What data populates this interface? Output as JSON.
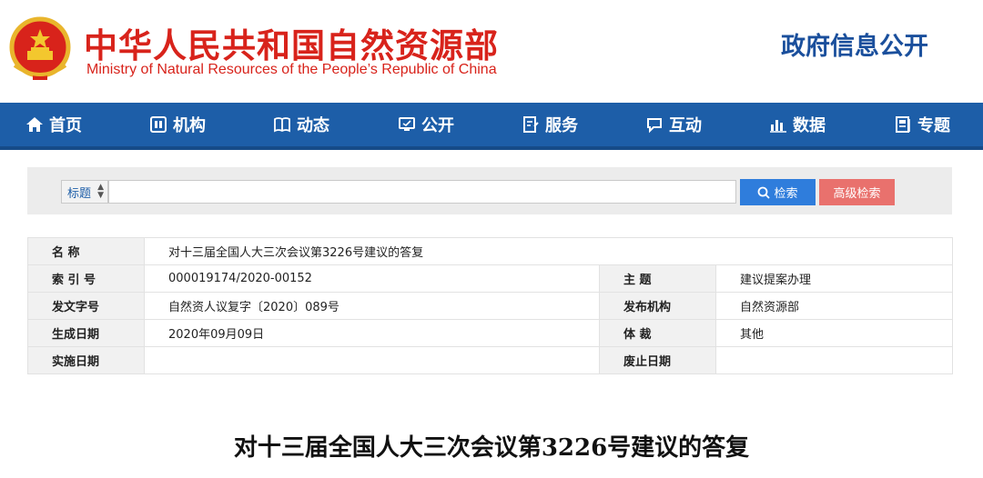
{
  "header": {
    "title_cn": "中华人民共和国自然资源部",
    "title_en": "Ministry of Natural Resources of the People’s Republic of China",
    "gov_info": "政府信息公开"
  },
  "nav": {
    "items": [
      {
        "label": "首页",
        "icon": "home-icon"
      },
      {
        "label": "机构",
        "icon": "org-icon"
      },
      {
        "label": "动态",
        "icon": "book-icon"
      },
      {
        "label": "公开",
        "icon": "monitor-icon"
      },
      {
        "label": "服务",
        "icon": "doc-edit-icon"
      },
      {
        "label": "互动",
        "icon": "chat-icon"
      },
      {
        "label": "数据",
        "icon": "bar-chart-icon"
      },
      {
        "label": "专题",
        "icon": "album-icon"
      }
    ]
  },
  "search": {
    "field_select": "标题",
    "input_value": "",
    "search_label": "检索",
    "advanced_label": "高级检索"
  },
  "info": {
    "name_label": "名 称",
    "name_value": "对十三届全国人大三次会议第3226号建议的答复",
    "index_label": "索 引 号",
    "index_value": "000019174/2020-00152",
    "subject_label": "主 题",
    "subject_value": "建议提案办理",
    "docno_label": "发文字号",
    "docno_value": "自然资人议复字〔2020〕089号",
    "issuer_label": "发布机构",
    "issuer_value": "自然资源部",
    "created_label": "生成日期",
    "created_value": "2020年09月09日",
    "genre_label": "体 裁",
    "genre_value": "其他",
    "effective_label": "实施日期",
    "effective_value": "",
    "expiry_label": "废止日期",
    "expiry_value": ""
  },
  "document": {
    "title": "对十三届全国人大三次会议第3226号建议的答复"
  },
  "colors": {
    "brand_red": "#d8231b",
    "nav_blue": "#1d5ea8",
    "search_blue": "#2f7ddc",
    "advanced_red": "#e9716d"
  }
}
